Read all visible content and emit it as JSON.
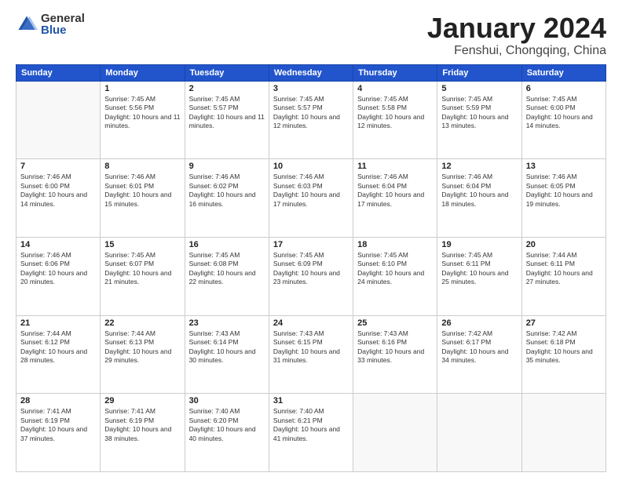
{
  "logo": {
    "general": "General",
    "blue": "Blue"
  },
  "title": "January 2024",
  "location": "Fenshui, Chongqing, China",
  "headers": [
    "Sunday",
    "Monday",
    "Tuesday",
    "Wednesday",
    "Thursday",
    "Friday",
    "Saturday"
  ],
  "weeks": [
    [
      {
        "day": "",
        "sunrise": "",
        "sunset": "",
        "daylight": ""
      },
      {
        "day": "1",
        "sunrise": "Sunrise: 7:45 AM",
        "sunset": "Sunset: 5:56 PM",
        "daylight": "Daylight: 10 hours and 11 minutes."
      },
      {
        "day": "2",
        "sunrise": "Sunrise: 7:45 AM",
        "sunset": "Sunset: 5:57 PM",
        "daylight": "Daylight: 10 hours and 11 minutes."
      },
      {
        "day": "3",
        "sunrise": "Sunrise: 7:45 AM",
        "sunset": "Sunset: 5:57 PM",
        "daylight": "Daylight: 10 hours and 12 minutes."
      },
      {
        "day": "4",
        "sunrise": "Sunrise: 7:45 AM",
        "sunset": "Sunset: 5:58 PM",
        "daylight": "Daylight: 10 hours and 12 minutes."
      },
      {
        "day": "5",
        "sunrise": "Sunrise: 7:45 AM",
        "sunset": "Sunset: 5:59 PM",
        "daylight": "Daylight: 10 hours and 13 minutes."
      },
      {
        "day": "6",
        "sunrise": "Sunrise: 7:45 AM",
        "sunset": "Sunset: 6:00 PM",
        "daylight": "Daylight: 10 hours and 14 minutes."
      }
    ],
    [
      {
        "day": "7",
        "sunrise": "Sunrise: 7:46 AM",
        "sunset": "Sunset: 6:00 PM",
        "daylight": "Daylight: 10 hours and 14 minutes."
      },
      {
        "day": "8",
        "sunrise": "Sunrise: 7:46 AM",
        "sunset": "Sunset: 6:01 PM",
        "daylight": "Daylight: 10 hours and 15 minutes."
      },
      {
        "day": "9",
        "sunrise": "Sunrise: 7:46 AM",
        "sunset": "Sunset: 6:02 PM",
        "daylight": "Daylight: 10 hours and 16 minutes."
      },
      {
        "day": "10",
        "sunrise": "Sunrise: 7:46 AM",
        "sunset": "Sunset: 6:03 PM",
        "daylight": "Daylight: 10 hours and 17 minutes."
      },
      {
        "day": "11",
        "sunrise": "Sunrise: 7:46 AM",
        "sunset": "Sunset: 6:04 PM",
        "daylight": "Daylight: 10 hours and 17 minutes."
      },
      {
        "day": "12",
        "sunrise": "Sunrise: 7:46 AM",
        "sunset": "Sunset: 6:04 PM",
        "daylight": "Daylight: 10 hours and 18 minutes."
      },
      {
        "day": "13",
        "sunrise": "Sunrise: 7:46 AM",
        "sunset": "Sunset: 6:05 PM",
        "daylight": "Daylight: 10 hours and 19 minutes."
      }
    ],
    [
      {
        "day": "14",
        "sunrise": "Sunrise: 7:46 AM",
        "sunset": "Sunset: 6:06 PM",
        "daylight": "Daylight: 10 hours and 20 minutes."
      },
      {
        "day": "15",
        "sunrise": "Sunrise: 7:45 AM",
        "sunset": "Sunset: 6:07 PM",
        "daylight": "Daylight: 10 hours and 21 minutes."
      },
      {
        "day": "16",
        "sunrise": "Sunrise: 7:45 AM",
        "sunset": "Sunset: 6:08 PM",
        "daylight": "Daylight: 10 hours and 22 minutes."
      },
      {
        "day": "17",
        "sunrise": "Sunrise: 7:45 AM",
        "sunset": "Sunset: 6:09 PM",
        "daylight": "Daylight: 10 hours and 23 minutes."
      },
      {
        "day": "18",
        "sunrise": "Sunrise: 7:45 AM",
        "sunset": "Sunset: 6:10 PM",
        "daylight": "Daylight: 10 hours and 24 minutes."
      },
      {
        "day": "19",
        "sunrise": "Sunrise: 7:45 AM",
        "sunset": "Sunset: 6:11 PM",
        "daylight": "Daylight: 10 hours and 25 minutes."
      },
      {
        "day": "20",
        "sunrise": "Sunrise: 7:44 AM",
        "sunset": "Sunset: 6:11 PM",
        "daylight": "Daylight: 10 hours and 27 minutes."
      }
    ],
    [
      {
        "day": "21",
        "sunrise": "Sunrise: 7:44 AM",
        "sunset": "Sunset: 6:12 PM",
        "daylight": "Daylight: 10 hours and 28 minutes."
      },
      {
        "day": "22",
        "sunrise": "Sunrise: 7:44 AM",
        "sunset": "Sunset: 6:13 PM",
        "daylight": "Daylight: 10 hours and 29 minutes."
      },
      {
        "day": "23",
        "sunrise": "Sunrise: 7:43 AM",
        "sunset": "Sunset: 6:14 PM",
        "daylight": "Daylight: 10 hours and 30 minutes."
      },
      {
        "day": "24",
        "sunrise": "Sunrise: 7:43 AM",
        "sunset": "Sunset: 6:15 PM",
        "daylight": "Daylight: 10 hours and 31 minutes."
      },
      {
        "day": "25",
        "sunrise": "Sunrise: 7:43 AM",
        "sunset": "Sunset: 6:16 PM",
        "daylight": "Daylight: 10 hours and 33 minutes."
      },
      {
        "day": "26",
        "sunrise": "Sunrise: 7:42 AM",
        "sunset": "Sunset: 6:17 PM",
        "daylight": "Daylight: 10 hours and 34 minutes."
      },
      {
        "day": "27",
        "sunrise": "Sunrise: 7:42 AM",
        "sunset": "Sunset: 6:18 PM",
        "daylight": "Daylight: 10 hours and 35 minutes."
      }
    ],
    [
      {
        "day": "28",
        "sunrise": "Sunrise: 7:41 AM",
        "sunset": "Sunset: 6:19 PM",
        "daylight": "Daylight: 10 hours and 37 minutes."
      },
      {
        "day": "29",
        "sunrise": "Sunrise: 7:41 AM",
        "sunset": "Sunset: 6:19 PM",
        "daylight": "Daylight: 10 hours and 38 minutes."
      },
      {
        "day": "30",
        "sunrise": "Sunrise: 7:40 AM",
        "sunset": "Sunset: 6:20 PM",
        "daylight": "Daylight: 10 hours and 40 minutes."
      },
      {
        "day": "31",
        "sunrise": "Sunrise: 7:40 AM",
        "sunset": "Sunset: 6:21 PM",
        "daylight": "Daylight: 10 hours and 41 minutes."
      },
      {
        "day": "",
        "sunrise": "",
        "sunset": "",
        "daylight": ""
      },
      {
        "day": "",
        "sunrise": "",
        "sunset": "",
        "daylight": ""
      },
      {
        "day": "",
        "sunrise": "",
        "sunset": "",
        "daylight": ""
      }
    ]
  ]
}
